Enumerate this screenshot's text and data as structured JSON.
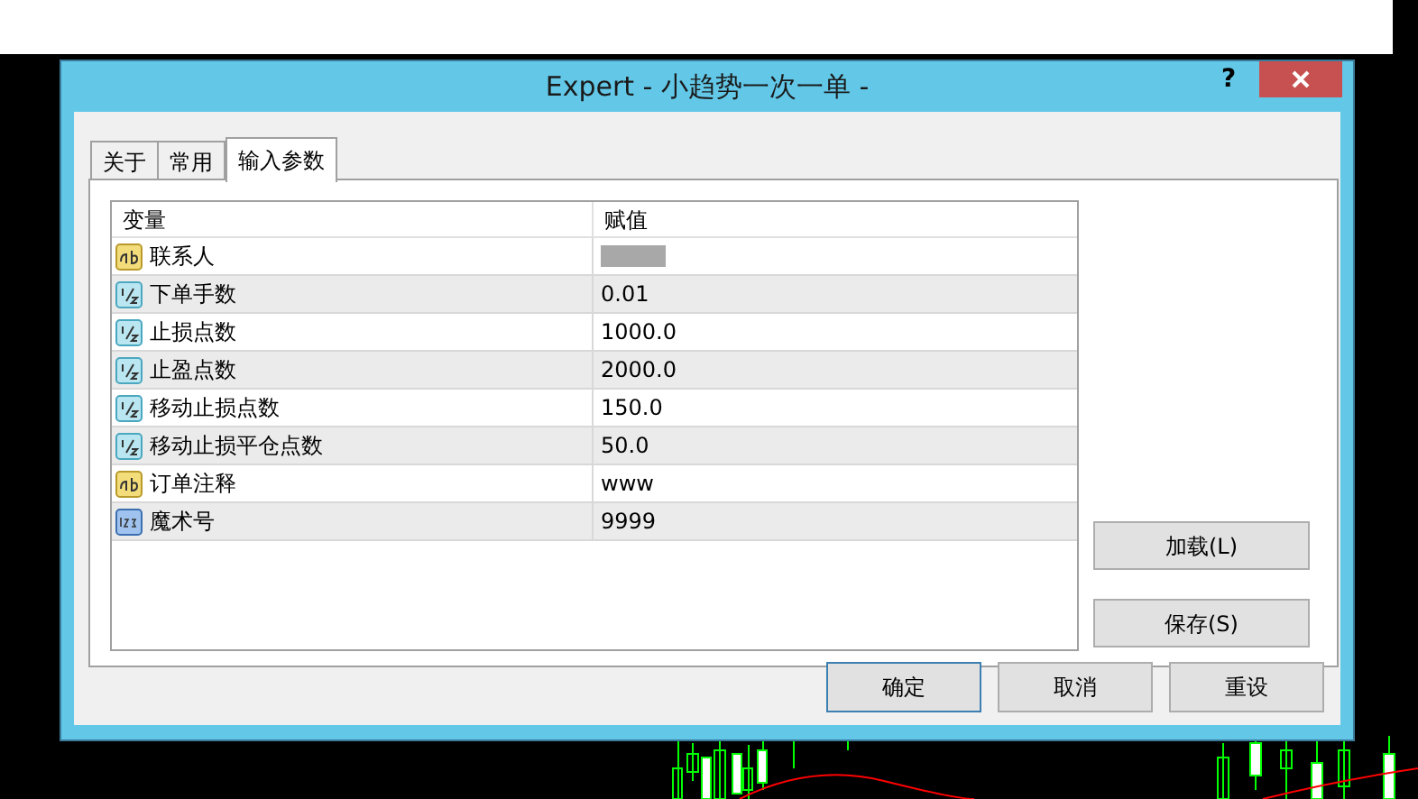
{
  "window": {
    "title": "Expert - 小趋势一次一单 -",
    "help_button": "?"
  },
  "tabs": [
    {
      "label": "关于",
      "selected": false
    },
    {
      "label": "常用",
      "selected": false
    },
    {
      "label": "输入参数",
      "selected": true
    }
  ],
  "table": {
    "columns": [
      "变量",
      "赋值"
    ],
    "rows": [
      {
        "kind": "string",
        "name": "联系人",
        "value_redacted": true
      },
      {
        "kind": "double",
        "name": "下单手数",
        "value": "0.01"
      },
      {
        "kind": "double",
        "name": "止损点数",
        "value": "1000.0"
      },
      {
        "kind": "double",
        "name": "止盈点数",
        "value": "2000.0"
      },
      {
        "kind": "double",
        "name": "移动止损点数",
        "value": "150.0"
      },
      {
        "kind": "double",
        "name": "移动止损平仓点数",
        "value": "50.0"
      },
      {
        "kind": "string",
        "name": "订单注释",
        "value": "www"
      },
      {
        "kind": "int",
        "name": "魔术号",
        "value": "9999"
      }
    ]
  },
  "side_buttons": [
    "加载(L)",
    "保存(S)"
  ],
  "buttons": [
    {
      "label": "确定",
      "default": true
    },
    {
      "label": "取消",
      "default": false
    },
    {
      "label": "重设",
      "default": false
    }
  ]
}
